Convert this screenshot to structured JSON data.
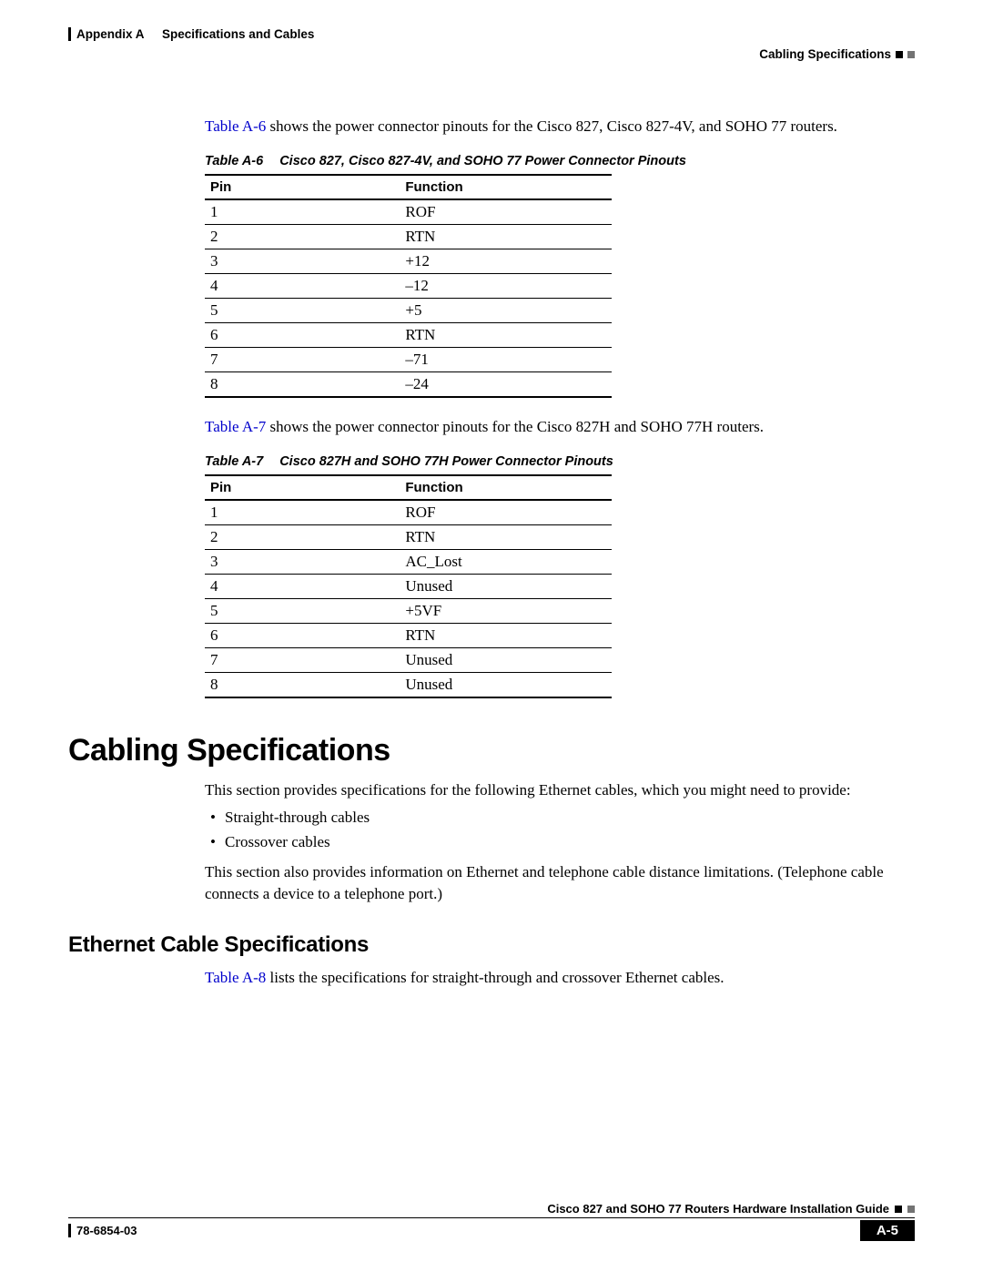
{
  "header": {
    "appendix": "Appendix A",
    "title": "Specifications and Cables",
    "section": "Cabling Specifications"
  },
  "p1_link": "Table A-6",
  "p1_rest": " shows the power connector pinouts for the Cisco 827, Cisco 827-4V, and SOHO 77 routers.",
  "tableA6": {
    "cap_num": "Table A-6",
    "cap_title": "Cisco 827, Cisco 827-4V, and SOHO 77 Power Connector Pinouts",
    "head_pin": "Pin",
    "head_func": "Function",
    "rows": [
      {
        "pin": "1",
        "func": "ROF"
      },
      {
        "pin": "2",
        "func": "RTN"
      },
      {
        "pin": "3",
        "func": "+12"
      },
      {
        "pin": "4",
        "func": "–12"
      },
      {
        "pin": "5",
        "func": "+5"
      },
      {
        "pin": "6",
        "func": "RTN"
      },
      {
        "pin": "7",
        "func": "–71"
      },
      {
        "pin": "8",
        "func": "–24"
      }
    ]
  },
  "p2_link": "Table A-7",
  "p2_rest": " shows the power connector pinouts for the Cisco 827H and SOHO 77H routers.",
  "tableA7": {
    "cap_num": "Table A-7",
    "cap_title": "Cisco 827H and SOHO 77H Power Connector Pinouts",
    "head_pin": "Pin",
    "head_func": "Function",
    "rows": [
      {
        "pin": "1",
        "func": "ROF"
      },
      {
        "pin": "2",
        "func": "RTN"
      },
      {
        "pin": "3",
        "func": "AC_Lost"
      },
      {
        "pin": "4",
        "func": "Unused"
      },
      {
        "pin": "5",
        "func": "+5VF"
      },
      {
        "pin": "6",
        "func": "RTN"
      },
      {
        "pin": "7",
        "func": "Unused"
      },
      {
        "pin": "8",
        "func": "Unused"
      }
    ]
  },
  "h1": "Cabling Specifications",
  "h1_p1": "This section provides specifications for the following Ethernet cables, which you might need to provide:",
  "bullets": [
    "Straight-through cables",
    "Crossover cables"
  ],
  "h1_p2": "This section also provides information on Ethernet and telephone cable distance limitations. (Telephone cable connects a device to a telephone port.)",
  "h2": "Ethernet Cable Specifications",
  "h2_p_link": "Table A-8",
  "h2_p_rest": " lists the specifications for straight-through and crossover Ethernet cables.",
  "footer": {
    "book": "Cisco 827 and SOHO 77 Routers Hardware Installation Guide",
    "docnum": "78-6854-03",
    "page": "A-5"
  }
}
